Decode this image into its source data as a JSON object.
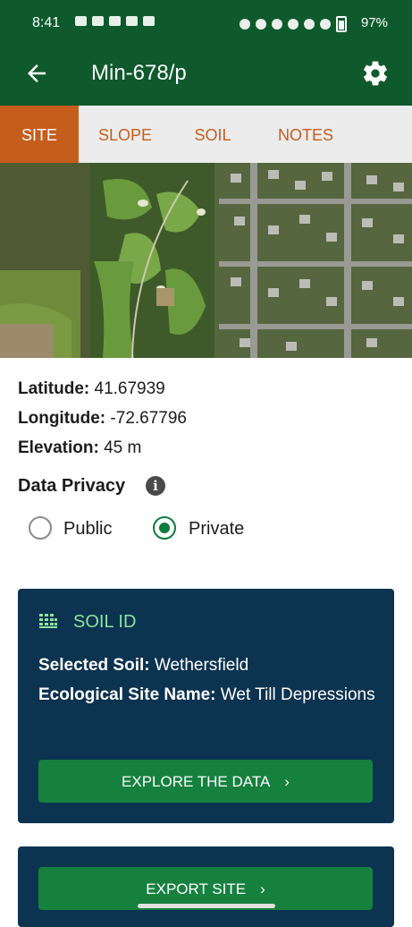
{
  "status_bar": {
    "time": "8:41",
    "battery": "97%"
  },
  "app_bar": {
    "title": "Min-678/p",
    "back_icon": "arrow-left-icon",
    "settings_icon": "gear-icon"
  },
  "tabs": [
    {
      "label": "SITE",
      "active": true
    },
    {
      "label": "SLOPE",
      "active": false
    },
    {
      "label": "SOIL",
      "active": false
    },
    {
      "label": "NOTES",
      "active": false
    }
  ],
  "site": {
    "latitude_label": "Latitude:",
    "latitude_value": "41.67939",
    "longitude_label": "Longitude:",
    "longitude_value": "-72.67796",
    "elevation_label": "Elevation:",
    "elevation_value": "45 m"
  },
  "privacy": {
    "heading": "Data Privacy",
    "options": [
      {
        "label": "Public",
        "selected": false
      },
      {
        "label": "Private",
        "selected": true
      }
    ]
  },
  "soil_id": {
    "title": "SOIL ID",
    "selected_soil_label": "Selected Soil:",
    "selected_soil_value": "Wethersfield",
    "eco_site_label": "Ecological Site Name:",
    "eco_site_value": "Wet Till Depressions",
    "explore_button": "EXPLORE THE DATA"
  },
  "export": {
    "button": "EXPORT SITE"
  },
  "colors": {
    "primary": "#0f5a2c",
    "tab_accent": "#c55d1d",
    "card_bg": "#0c3350",
    "button_green": "#16813f",
    "soil_title": "#8de59f"
  }
}
